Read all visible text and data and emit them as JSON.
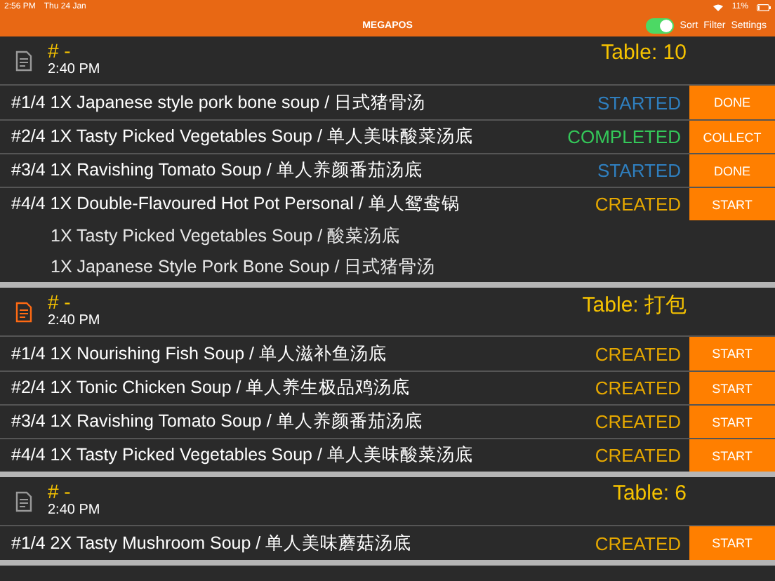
{
  "status_bar": {
    "time": "2:56 PM",
    "date": "Thu 24 Jan",
    "battery": "11%"
  },
  "nav_bar": {
    "title": "MEGAPOS",
    "toggle": {
      "on": true
    },
    "actions": [
      "Sort",
      "Filter",
      "Settings"
    ]
  },
  "orders": [
    {
      "number": "# -",
      "time": "2:40 PM",
      "table": "Table: 10",
      "icon_highlighted": false,
      "items": [
        {
          "text": "#1/4 1X Japanese style pork bone soup / 日式猪骨汤",
          "status": "STARTED",
          "color": "#2f7fbf",
          "action": "DONE"
        },
        {
          "text": "#2/4 1X Tasty Picked Vegetables Soup / 单人美味酸菜汤底",
          "status": "COMPLETED",
          "color": "#34c759",
          "action": "COLLECT"
        },
        {
          "text": "#3/4 1X Ravishing Tomato Soup / 单人养颜番茄汤底",
          "status": "STARTED",
          "color": "#2f7fbf",
          "action": "DONE"
        },
        {
          "text": "#4/4 1X Double-Flavoured Hot Pot Personal / 单人鸳鸯锅",
          "status": "CREATED",
          "color": "#e6a800",
          "action": "START",
          "children": [
            "1X Tasty Picked Vegetables Soup / 酸菜汤底",
            "1X Japanese Style Pork Bone Soup / 日式猪骨汤"
          ]
        }
      ]
    },
    {
      "number": "# -",
      "time": "2:40 PM",
      "table": "Table: 打包",
      "icon_highlighted": true,
      "items": [
        {
          "text": "#1/4 1X Nourishing Fish Soup / 单人滋补鱼汤底",
          "status": "CREATED",
          "color": "#e6a800",
          "action": "START"
        },
        {
          "text": "#2/4 1X Tonic Chicken Soup / 单人养生极品鸡汤底",
          "status": "CREATED",
          "color": "#e6a800",
          "action": "START"
        },
        {
          "text": "#3/4 1X Ravishing Tomato Soup / 单人养颜番茄汤底",
          "status": "CREATED",
          "color": "#e6a800",
          "action": "START"
        },
        {
          "text": "#4/4 1X Tasty Picked Vegetables Soup / 单人美味酸菜汤底",
          "status": "CREATED",
          "color": "#e6a800",
          "action": "START"
        }
      ]
    },
    {
      "number": "# -",
      "time": "2:40 PM",
      "table": "Table: 6",
      "icon_highlighted": false,
      "items": [
        {
          "text": "#1/4 2X Tasty Mushroom Soup / 单人美味蘑菇汤底",
          "status": "CREATED",
          "color": "#e6a800",
          "action": "START"
        }
      ]
    }
  ]
}
